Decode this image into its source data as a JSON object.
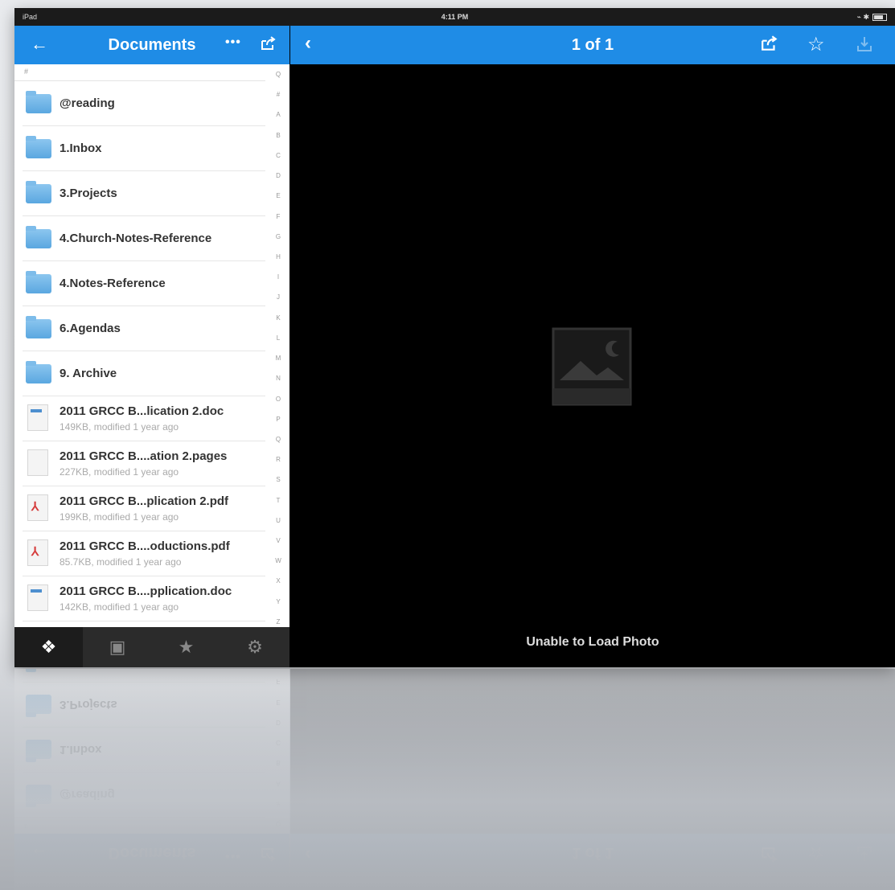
{
  "status_bar": {
    "carrier": "iPad",
    "time": "4:11 PM"
  },
  "left_panel": {
    "back_icon": "arrow-left-icon",
    "title": "Documents",
    "more_label": "•••",
    "share_icon": "share-icon",
    "index_letters": [
      "Q",
      "#",
      "A",
      "B",
      "C",
      "D",
      "E",
      "F",
      "G",
      "H",
      "I",
      "J",
      "K",
      "L",
      "M",
      "N",
      "O",
      "P",
      "Q",
      "R",
      "S",
      "T",
      "U",
      "V",
      "W",
      "X",
      "Y",
      "Z"
    ],
    "items": [
      {
        "type": "folder",
        "name": "@reading"
      },
      {
        "type": "folder",
        "name": "1.Inbox"
      },
      {
        "type": "folder",
        "name": "3.Projects"
      },
      {
        "type": "folder",
        "name": "4.Church-Notes-Reference"
      },
      {
        "type": "folder",
        "name": "4.Notes-Reference"
      },
      {
        "type": "folder",
        "name": "6.Agendas"
      },
      {
        "type": "folder",
        "name": "9. Archive"
      },
      {
        "type": "word",
        "name": "2011 GRCC B...lication 2.doc",
        "meta": "149KB, modified 1 year ago"
      },
      {
        "type": "pages",
        "name": "2011 GRCC B....ation 2.pages",
        "meta": "227KB, modified 1 year ago"
      },
      {
        "type": "pdf",
        "name": "2011 GRCC B...plication 2.pdf",
        "meta": "199KB, modified 1 year ago"
      },
      {
        "type": "pdf",
        "name": "2011 GRCC B....oductions.pdf",
        "meta": "85.7KB, modified 1 year ago"
      },
      {
        "type": "word",
        "name": "2011 GRCC B....pplication.doc",
        "meta": "142KB, modified 1 year ago"
      }
    ],
    "tabs": [
      {
        "icon": "dropbox-icon",
        "active": true
      },
      {
        "icon": "photos-icon",
        "active": false
      },
      {
        "icon": "star-icon",
        "active": false
      },
      {
        "icon": "gear-icon",
        "active": false
      }
    ]
  },
  "right_panel": {
    "page_indicator": "1 of 1",
    "back_icon": "chevron-left-icon",
    "message": "Unable to Load Photo",
    "placeholder_icon": "broken-image-icon"
  },
  "colors": {
    "accent": "#1f8ce6",
    "tabbar": "#2b2b2b",
    "viewer_bg": "#000000"
  }
}
